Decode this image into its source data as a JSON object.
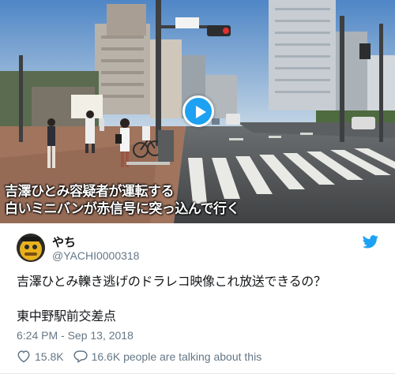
{
  "media": {
    "caption_line1": "吉澤ひとみ容疑者が運転する",
    "caption_line2": "白いミニバンが赤信号に突っ込んで行く",
    "play_icon": "play-icon"
  },
  "author": {
    "display_name": "やち",
    "screen_name": "@YACHI0000318",
    "avatar_icon": "avatar"
  },
  "tweet": {
    "text_line1": "吉澤ひとみ轢き逃げのドラレコ映像これ放送できるの？",
    "text_line2": "東中野駅前交差点",
    "timestamp": "6:24 PM - Sep 13, 2018"
  },
  "stats": {
    "likes": "15.8K",
    "talking": "16.6K people are talking about this"
  },
  "colors": {
    "twitter_blue": "#1da1f2",
    "secondary_text": "#657786",
    "primary_text": "#14171a"
  },
  "icons": [
    "twitter-bird-icon",
    "heart-icon",
    "speech-bubble-icon",
    "play-icon"
  ]
}
